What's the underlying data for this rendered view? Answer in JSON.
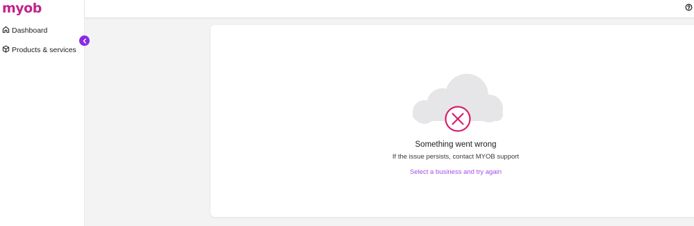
{
  "brand": {
    "logo_text": "myob",
    "accent_color": "#c2238c",
    "link_color": "#a44de3",
    "collapse_color": "#8a2be2"
  },
  "sidebar": {
    "items": [
      {
        "label": "Dashboard",
        "icon": "home-icon"
      },
      {
        "label": "Products & services",
        "icon": "box-icon"
      }
    ],
    "collapse_icon": "chevron-left-icon"
  },
  "topbar": {
    "help_icon": "help-circle-icon"
  },
  "error": {
    "illustration_icon": "cloud-error-icon",
    "title": "Something went wrong",
    "subtitle": "If the issue persists, contact MYOB support",
    "action_link": "Select a business and try again"
  }
}
